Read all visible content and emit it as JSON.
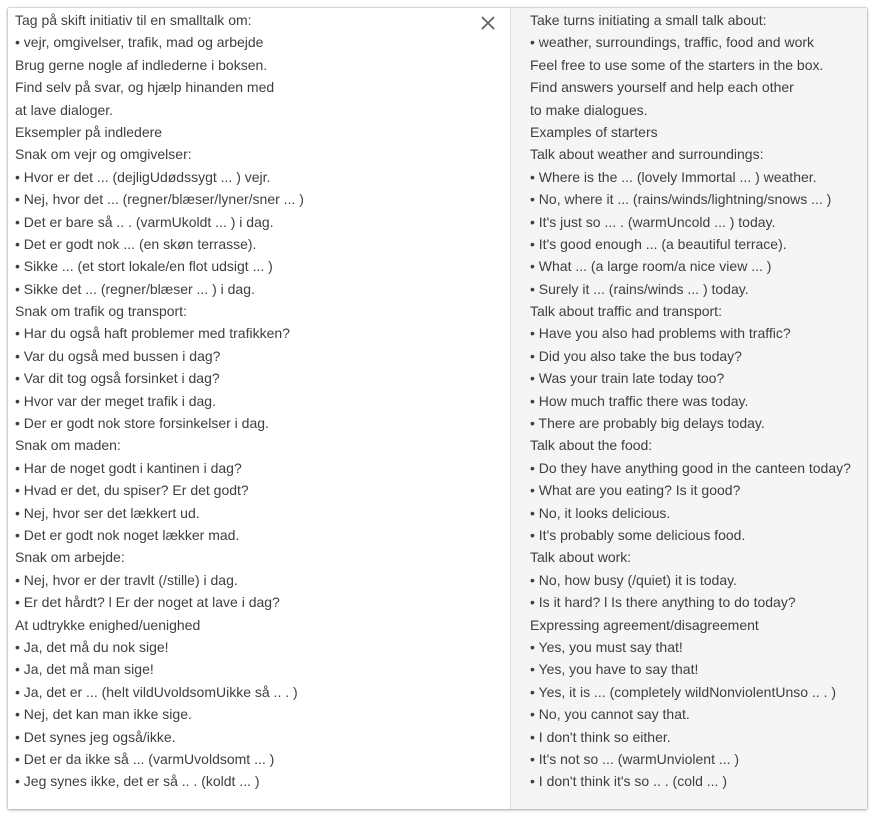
{
  "source": {
    "lines": [
      "Tag på skift initiativ til en smalltalk om:",
      "• vejr, omgivelser, trafik, mad og arbejde",
      "Brug gerne nogle af indlederne i boksen.",
      "Find selv på svar, og hjælp hinanden med",
      "at lave dialoger.",
      "Eksempler på indledere",
      "Snak om vejr og omgivelser:",
      "• Hvor er det ... (dejligUdødssygt ... ) vejr.",
      "• Nej, hvor det ... (regner/blæser/lyner/sner ... )",
      "• Det er bare så .. . (varmUkoldt ... ) i dag.",
      "• Det er godt nok ... (en skøn terrasse).",
      "• Sikke ... (et stort lokale/en flot udsigt ... )",
      "• Sikke det ... (regner/blæser ... ) i dag.",
      "Snak om trafik og transport:",
      "• Har du også haft problemer med trafikken?",
      "• Var du også med bussen i dag?",
      "• Var dit tog også forsinket i dag?",
      "• Hvor var der meget trafik i dag.",
      "• Der er godt nok store forsinkelser i dag.",
      "Snak om maden:",
      "• Har de noget godt i kantinen i dag?",
      "• Hvad er det, du spiser? Er det godt?",
      "• Nej, hvor ser det lækkert ud.",
      "• Det er godt nok noget lækker mad.",
      "Snak om arbejde:",
      "• Nej, hvor er der travlt (/stille) i dag.",
      "• Er det hårdt? l Er der noget at lave i dag?",
      "At udtrykke enighed/uenighed",
      "• Ja, det må du nok sige!",
      "• Ja, det må man sige!",
      "• Ja, det er ... (helt vildUvoldsomUikke så .. . )",
      "• Nej, det kan man ikke sige.",
      "• Det synes jeg også/ikke.",
      "• Det er da ikke så ... (varmUvoldsomt ... )",
      "• Jeg synes ikke, det er så .. . (koldt ... )"
    ]
  },
  "target": {
    "lines": [
      "Take turns initiating a small talk about:",
      "• weather, surroundings, traffic, food and work",
      "Feel free to use some of the starters in the box.",
      "Find answers yourself and help each other",
      "to make dialogues.",
      "Examples of starters",
      "Talk about weather and surroundings:",
      "• Where is the ... (lovely Immortal ... ) weather.",
      "• No, where it ... (rains/winds/lightning/snows ... )",
      "• It's just so ... . (warmUncold ... ) today.",
      "• It's good enough ... (a beautiful terrace).",
      "• What ... (a large room/a nice view ... )",
      "• Surely it ... (rains/winds ... ) today.",
      "Talk about traffic and transport:",
      "• Have you also had problems with traffic?",
      "• Did you also take the bus today?",
      "• Was your train late today too?",
      "• How much traffic there was today.",
      "• There are probably big delays today.",
      "Talk about the food:",
      "• Do they have anything good in the canteen today?",
      "• What are you eating? Is it good?",
      "• No, it looks delicious.",
      "• It's probably some delicious food.",
      "Talk about work:",
      "• No, how busy (/quiet) it is today.",
      "• Is it hard? l Is there anything to do today?",
      "Expressing agreement/disagreement",
      "• Yes, you must say that!",
      "• Yes, you have to say that!",
      "• Yes, it is ... (completely wildNonviolentUnso .. . )",
      "• No, you cannot say that.",
      "• I don't think so either.",
      "• It's not so ... (warmUnviolent ... )",
      "• I don't think it's so .. . (cold ... )"
    ]
  },
  "close_icon": "close-icon",
  "colors": {
    "text": "#3c4043",
    "target_bg": "#f5f5f5",
    "divider": "#dadce0",
    "icon": "#5f6368"
  }
}
